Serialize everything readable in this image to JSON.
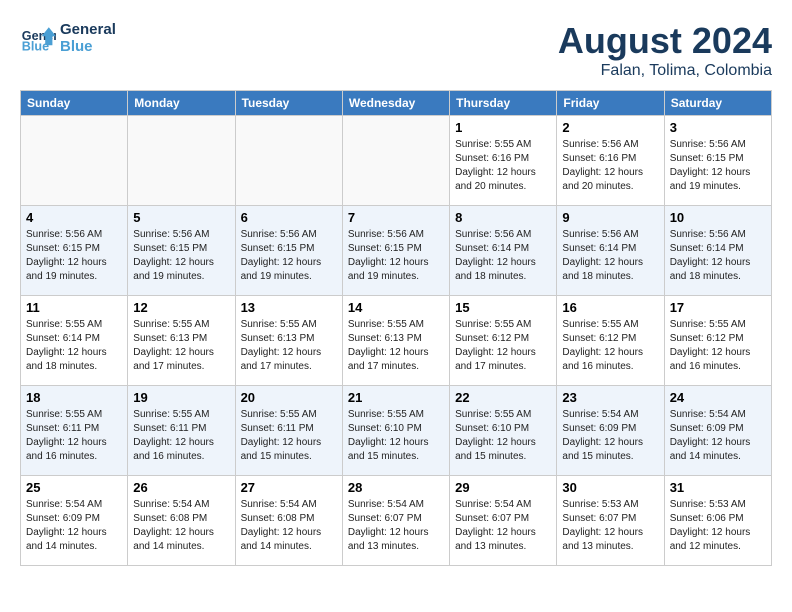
{
  "header": {
    "logo_line1": "General",
    "logo_line2": "Blue",
    "month": "August 2024",
    "location": "Falan, Tolima, Colombia"
  },
  "days_of_week": [
    "Sunday",
    "Monday",
    "Tuesday",
    "Wednesday",
    "Thursday",
    "Friday",
    "Saturday"
  ],
  "weeks": [
    [
      {
        "day": "",
        "info": ""
      },
      {
        "day": "",
        "info": ""
      },
      {
        "day": "",
        "info": ""
      },
      {
        "day": "",
        "info": ""
      },
      {
        "day": "1",
        "info": "Sunrise: 5:55 AM\nSunset: 6:16 PM\nDaylight: 12 hours\nand 20 minutes."
      },
      {
        "day": "2",
        "info": "Sunrise: 5:56 AM\nSunset: 6:16 PM\nDaylight: 12 hours\nand 20 minutes."
      },
      {
        "day": "3",
        "info": "Sunrise: 5:56 AM\nSunset: 6:15 PM\nDaylight: 12 hours\nand 19 minutes."
      }
    ],
    [
      {
        "day": "4",
        "info": "Sunrise: 5:56 AM\nSunset: 6:15 PM\nDaylight: 12 hours\nand 19 minutes."
      },
      {
        "day": "5",
        "info": "Sunrise: 5:56 AM\nSunset: 6:15 PM\nDaylight: 12 hours\nand 19 minutes."
      },
      {
        "day": "6",
        "info": "Sunrise: 5:56 AM\nSunset: 6:15 PM\nDaylight: 12 hours\nand 19 minutes."
      },
      {
        "day": "7",
        "info": "Sunrise: 5:56 AM\nSunset: 6:15 PM\nDaylight: 12 hours\nand 19 minutes."
      },
      {
        "day": "8",
        "info": "Sunrise: 5:56 AM\nSunset: 6:14 PM\nDaylight: 12 hours\nand 18 minutes."
      },
      {
        "day": "9",
        "info": "Sunrise: 5:56 AM\nSunset: 6:14 PM\nDaylight: 12 hours\nand 18 minutes."
      },
      {
        "day": "10",
        "info": "Sunrise: 5:56 AM\nSunset: 6:14 PM\nDaylight: 12 hours\nand 18 minutes."
      }
    ],
    [
      {
        "day": "11",
        "info": "Sunrise: 5:55 AM\nSunset: 6:14 PM\nDaylight: 12 hours\nand 18 minutes."
      },
      {
        "day": "12",
        "info": "Sunrise: 5:55 AM\nSunset: 6:13 PM\nDaylight: 12 hours\nand 17 minutes."
      },
      {
        "day": "13",
        "info": "Sunrise: 5:55 AM\nSunset: 6:13 PM\nDaylight: 12 hours\nand 17 minutes."
      },
      {
        "day": "14",
        "info": "Sunrise: 5:55 AM\nSunset: 6:13 PM\nDaylight: 12 hours\nand 17 minutes."
      },
      {
        "day": "15",
        "info": "Sunrise: 5:55 AM\nSunset: 6:12 PM\nDaylight: 12 hours\nand 17 minutes."
      },
      {
        "day": "16",
        "info": "Sunrise: 5:55 AM\nSunset: 6:12 PM\nDaylight: 12 hours\nand 16 minutes."
      },
      {
        "day": "17",
        "info": "Sunrise: 5:55 AM\nSunset: 6:12 PM\nDaylight: 12 hours\nand 16 minutes."
      }
    ],
    [
      {
        "day": "18",
        "info": "Sunrise: 5:55 AM\nSunset: 6:11 PM\nDaylight: 12 hours\nand 16 minutes."
      },
      {
        "day": "19",
        "info": "Sunrise: 5:55 AM\nSunset: 6:11 PM\nDaylight: 12 hours\nand 16 minutes."
      },
      {
        "day": "20",
        "info": "Sunrise: 5:55 AM\nSunset: 6:11 PM\nDaylight: 12 hours\nand 15 minutes."
      },
      {
        "day": "21",
        "info": "Sunrise: 5:55 AM\nSunset: 6:10 PM\nDaylight: 12 hours\nand 15 minutes."
      },
      {
        "day": "22",
        "info": "Sunrise: 5:55 AM\nSunset: 6:10 PM\nDaylight: 12 hours\nand 15 minutes."
      },
      {
        "day": "23",
        "info": "Sunrise: 5:54 AM\nSunset: 6:09 PM\nDaylight: 12 hours\nand 15 minutes."
      },
      {
        "day": "24",
        "info": "Sunrise: 5:54 AM\nSunset: 6:09 PM\nDaylight: 12 hours\nand 14 minutes."
      }
    ],
    [
      {
        "day": "25",
        "info": "Sunrise: 5:54 AM\nSunset: 6:09 PM\nDaylight: 12 hours\nand 14 minutes."
      },
      {
        "day": "26",
        "info": "Sunrise: 5:54 AM\nSunset: 6:08 PM\nDaylight: 12 hours\nand 14 minutes."
      },
      {
        "day": "27",
        "info": "Sunrise: 5:54 AM\nSunset: 6:08 PM\nDaylight: 12 hours\nand 14 minutes."
      },
      {
        "day": "28",
        "info": "Sunrise: 5:54 AM\nSunset: 6:07 PM\nDaylight: 12 hours\nand 13 minutes."
      },
      {
        "day": "29",
        "info": "Sunrise: 5:54 AM\nSunset: 6:07 PM\nDaylight: 12 hours\nand 13 minutes."
      },
      {
        "day": "30",
        "info": "Sunrise: 5:53 AM\nSunset: 6:07 PM\nDaylight: 12 hours\nand 13 minutes."
      },
      {
        "day": "31",
        "info": "Sunrise: 5:53 AM\nSunset: 6:06 PM\nDaylight: 12 hours\nand 12 minutes."
      }
    ]
  ]
}
